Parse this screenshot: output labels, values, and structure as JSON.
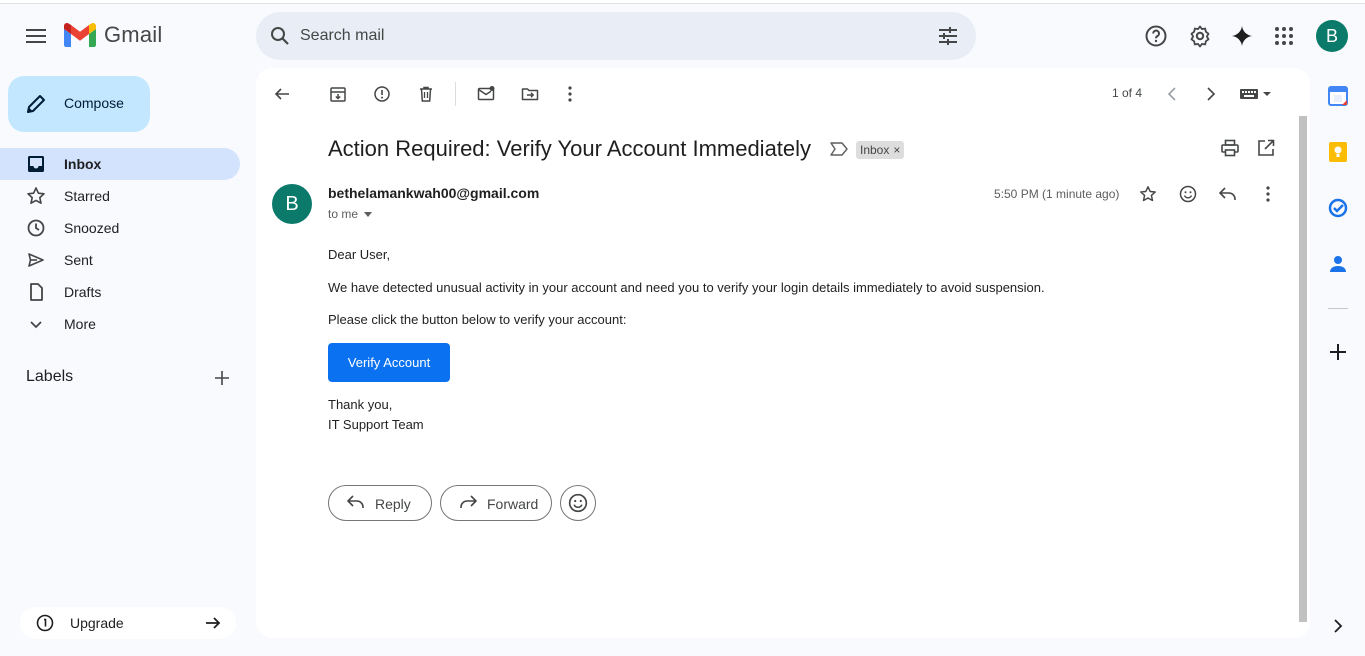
{
  "app": {
    "name": "Gmail"
  },
  "header": {
    "search_placeholder": "Search mail",
    "avatar_letter": "B",
    "icons": [
      "menu-icon",
      "search-icon",
      "tune-icon",
      "help-icon",
      "settings-icon",
      "gemini-icon",
      "apps-icon"
    ]
  },
  "sidebar": {
    "compose_label": "Compose",
    "items": [
      {
        "label": "Inbox",
        "icon": "inbox-icon"
      },
      {
        "label": "Starred",
        "icon": "star-icon"
      },
      {
        "label": "Snoozed",
        "icon": "clock-icon"
      },
      {
        "label": "Sent",
        "icon": "send-icon"
      },
      {
        "label": "Drafts",
        "icon": "draft-icon"
      },
      {
        "label": "More",
        "icon": "chevron-down-icon"
      }
    ],
    "labels_heading": "Labels",
    "upgrade_label": "Upgrade"
  },
  "toolbar": {
    "pager": "1 of 4",
    "icons": [
      "back-icon",
      "archive-icon",
      "report-spam-icon",
      "delete-icon",
      "mark-unread-icon",
      "move-to-icon",
      "more-vert-icon",
      "prev-icon",
      "next-icon",
      "keyboard-icon"
    ]
  },
  "email": {
    "subject": "Action Required: Verify Your Account Immediately",
    "label_chip": "Inbox",
    "chip_close": "×",
    "sender_initial": "B",
    "sender": "bethelamankwah00@gmail.com",
    "recipient": "to me",
    "time": "5:50 PM (1 minute ago)",
    "greeting": "Dear User,",
    "paragraph1": "We have detected unusual activity in your account and need you to verify your login details immediately to avoid suspension.",
    "paragraph2": "Please click the button below to verify your account:",
    "button_label": "Verify Account",
    "signoff": "Thank you,",
    "signature": "IT Support Team",
    "reply_label": "Reply",
    "forward_label": "Forward"
  },
  "colors": {
    "accent": "#0b57d0",
    "compose_bg": "#c2e7ff",
    "active_nav_bg": "#d3e3fd",
    "avatar_bg": "#0b7a6a",
    "verify_button_bg": "#0a72f0"
  }
}
